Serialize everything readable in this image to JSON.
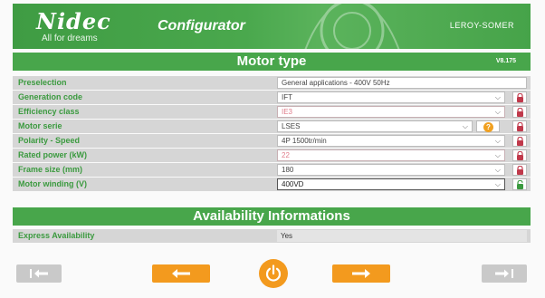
{
  "header": {
    "logo": "Nidec",
    "tagline": "All for dreams",
    "app_title": "Configurator",
    "brand": "LEROY-SOMER"
  },
  "motor_type": {
    "title": "Motor type",
    "version": "V8.175"
  },
  "form": {
    "rows": [
      {
        "label": "Preselection",
        "value": "General applications - 400V 50Hz"
      },
      {
        "label": "Generation code",
        "value": "IFT"
      },
      {
        "label": "Efficiency class",
        "value": "IE3"
      },
      {
        "label": "Motor serie",
        "value": "LSES"
      },
      {
        "label": "Polarity - Speed",
        "value": "4P 1500tr/min"
      },
      {
        "label": "Rated power (kW)",
        "value": "22"
      },
      {
        "label": "Frame size (mm)",
        "value": "180"
      },
      {
        "label": "Motor winding (V)",
        "value": "400VD"
      }
    ]
  },
  "availability": {
    "title": "Availability Informations",
    "label": "Express Availability",
    "value": "Yes"
  },
  "icons": {
    "lock_locked": "padlock-locked-icon",
    "lock_unlocked": "padlock-unlocked-icon",
    "help": "help-icon",
    "power": "power-icon"
  },
  "help_symbol": "?",
  "chevron": "⌵",
  "colors": {
    "brand_green": "#48a64b",
    "accent_orange": "#f39a1e",
    "label_green": "#3b9a3f",
    "lock_red": "#c0394b",
    "lock_green": "#3b9a3f"
  }
}
